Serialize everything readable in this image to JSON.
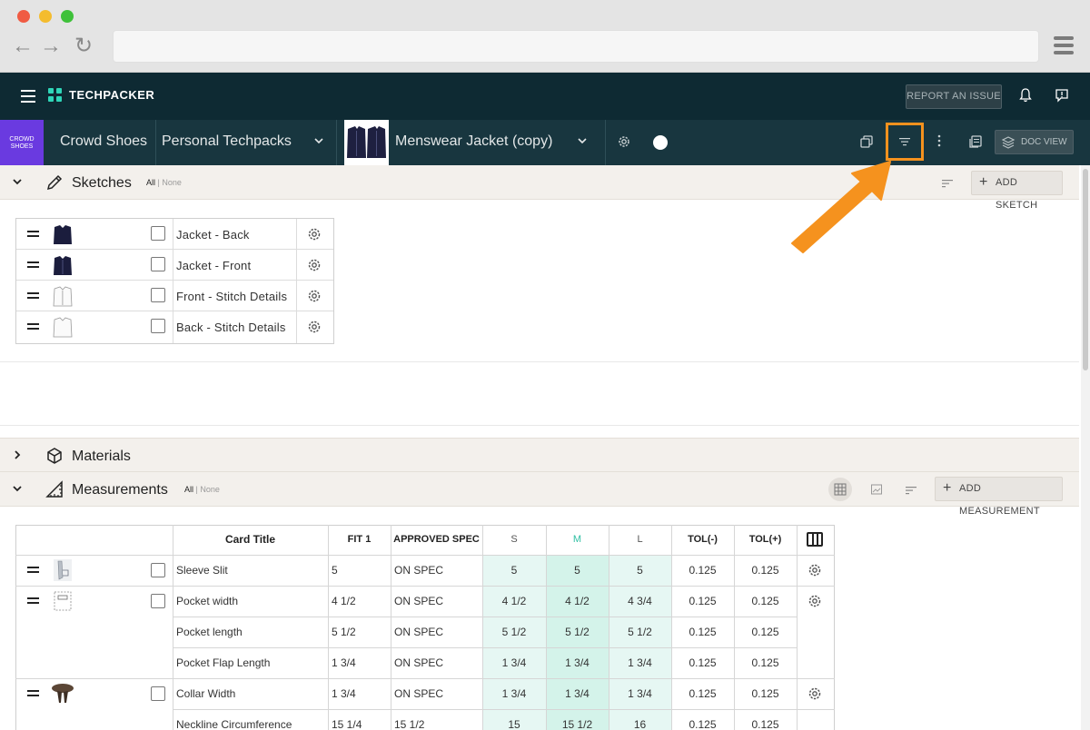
{
  "app": {
    "brand": "TECHPACKER",
    "report_issue": "REPORT AN ISSUE",
    "brand_tile": "CROWD SHOES"
  },
  "breadcrumb": {
    "brand": "Crowd Shoes",
    "folder": "Personal Techpacks",
    "techpack": "Menswear Jacket (copy)"
  },
  "toolbar": {
    "doc_view": "DOC VIEW"
  },
  "sketches": {
    "title": "Sketches",
    "all": "All",
    "sep": "|",
    "none": "None",
    "add_button": "ADD SKETCH",
    "items": [
      {
        "label": "Jacket - Back",
        "thumb": "jacket-back"
      },
      {
        "label": "Jacket - Front",
        "thumb": "jacket-front"
      },
      {
        "label": "Front - Stitch Details",
        "thumb": "stitch-front"
      },
      {
        "label": "Back - Stitch Details",
        "thumb": "stitch-back"
      }
    ]
  },
  "materials": {
    "title": "Materials"
  },
  "measurements": {
    "title": "Measurements",
    "all": "All",
    "sep": "|",
    "none": "None",
    "add_button": "ADD MEASUREMENT",
    "columns": [
      "Card Title",
      "FIT 1",
      "APPROVED SPEC",
      "S",
      "M",
      "L",
      "TOL(-)",
      "TOL(+)"
    ],
    "rows": [
      {
        "title": "Sleeve Slit",
        "fit": "5",
        "spec": "ON SPEC",
        "s": "5",
        "m": "5",
        "l": "5",
        "tol_minus": "0.125",
        "tol_plus": "0.125"
      },
      {
        "title": "Pocket width",
        "fit": "4 1/2",
        "spec": "ON SPEC",
        "s": "4 1/2",
        "m": "4 1/2",
        "l": "4 3/4",
        "tol_minus": "0.125",
        "tol_plus": "0.125"
      },
      {
        "title": "Pocket length",
        "fit": "5 1/2",
        "spec": "ON SPEC",
        "s": "5 1/2",
        "m": "5 1/2",
        "l": "5 1/2",
        "tol_minus": "0.125",
        "tol_plus": "0.125"
      },
      {
        "title": "Pocket Flap Length",
        "fit": "1 3/4",
        "spec": "ON SPEC",
        "s": "1 3/4",
        "m": "1 3/4",
        "l": "1 3/4",
        "tol_minus": "0.125",
        "tol_plus": "0.125"
      },
      {
        "title": "Collar Width",
        "fit": "1 3/4",
        "spec": "ON SPEC",
        "s": "1 3/4",
        "m": "1 3/4",
        "l": "1 3/4",
        "tol_minus": "0.125",
        "tol_plus": "0.125"
      },
      {
        "title": "Neckline Circumference",
        "fit": "15 1/4",
        "spec": "15 1/2",
        "s": "15",
        "m": "15 1/2",
        "l": "16",
        "tol_minus": "0.125",
        "tol_plus": "0.125"
      }
    ]
  },
  "colors": {
    "appbar": "#0e2a33",
    "crumbbar": "#18363f",
    "accent_highlight": "#f5921e",
    "teal": "#2fd6b8",
    "size_tint": "#e6f7f3",
    "brand_tile": "#6a3ae0"
  }
}
